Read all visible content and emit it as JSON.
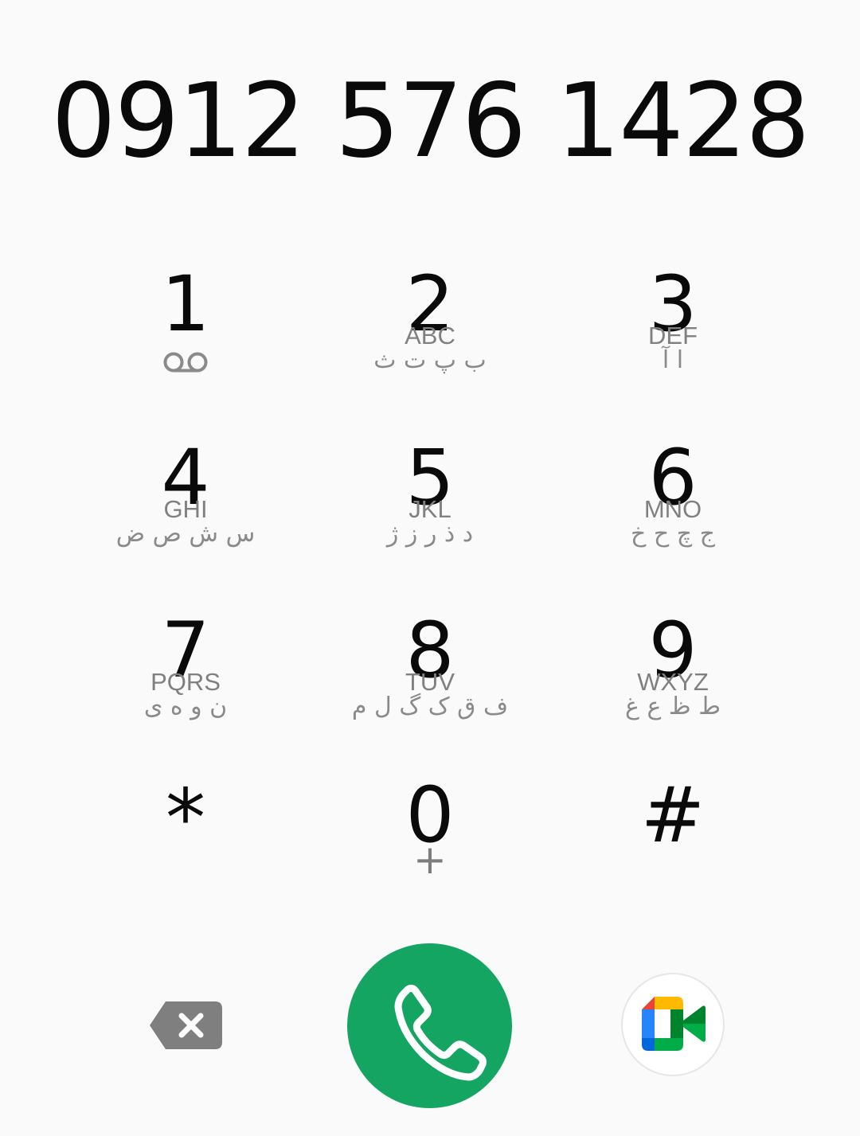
{
  "dialer": {
    "number": "0912 576 1428"
  },
  "keypad": {
    "row1": [
      {
        "digit": "1",
        "letters": "",
        "persian": "",
        "icon": "voicemail-icon"
      },
      {
        "digit": "2",
        "letters": "ABC",
        "persian": "ب پ ت ث"
      },
      {
        "digit": "3",
        "letters": "DEF",
        "persian": "ا آ"
      }
    ],
    "row2": [
      {
        "digit": "4",
        "letters": "GHI",
        "persian": "س ش ص ض"
      },
      {
        "digit": "5",
        "letters": "JKL",
        "persian": "د ذ ر ز ژ"
      },
      {
        "digit": "6",
        "letters": "MNO",
        "persian": "ج چ ح خ"
      }
    ],
    "row3": [
      {
        "digit": "7",
        "letters": "PQRS",
        "persian": "ن و ه ی"
      },
      {
        "digit": "8",
        "letters": "TUV",
        "persian": "ف ق ک گ ل م"
      },
      {
        "digit": "9",
        "letters": "WXYZ",
        "persian": "ط ظ ع غ"
      }
    ],
    "row4": [
      {
        "digit": "*",
        "sub": ""
      },
      {
        "digit": "0",
        "sub": "+"
      },
      {
        "digit": "#",
        "sub": ""
      }
    ]
  },
  "actions": {
    "backspace_icon": "backspace-icon",
    "call_icon": "phone-icon",
    "video_icon": "google-meet-icon"
  },
  "colors": {
    "call_green": "#15a563",
    "meet_blue": "#2684fc",
    "meet_red": "#ea4335",
    "meet_yellow": "#ffba00",
    "meet_green": "#00832d",
    "meet_darkgreen": "#00ac47",
    "secondary_text": "#808080"
  }
}
